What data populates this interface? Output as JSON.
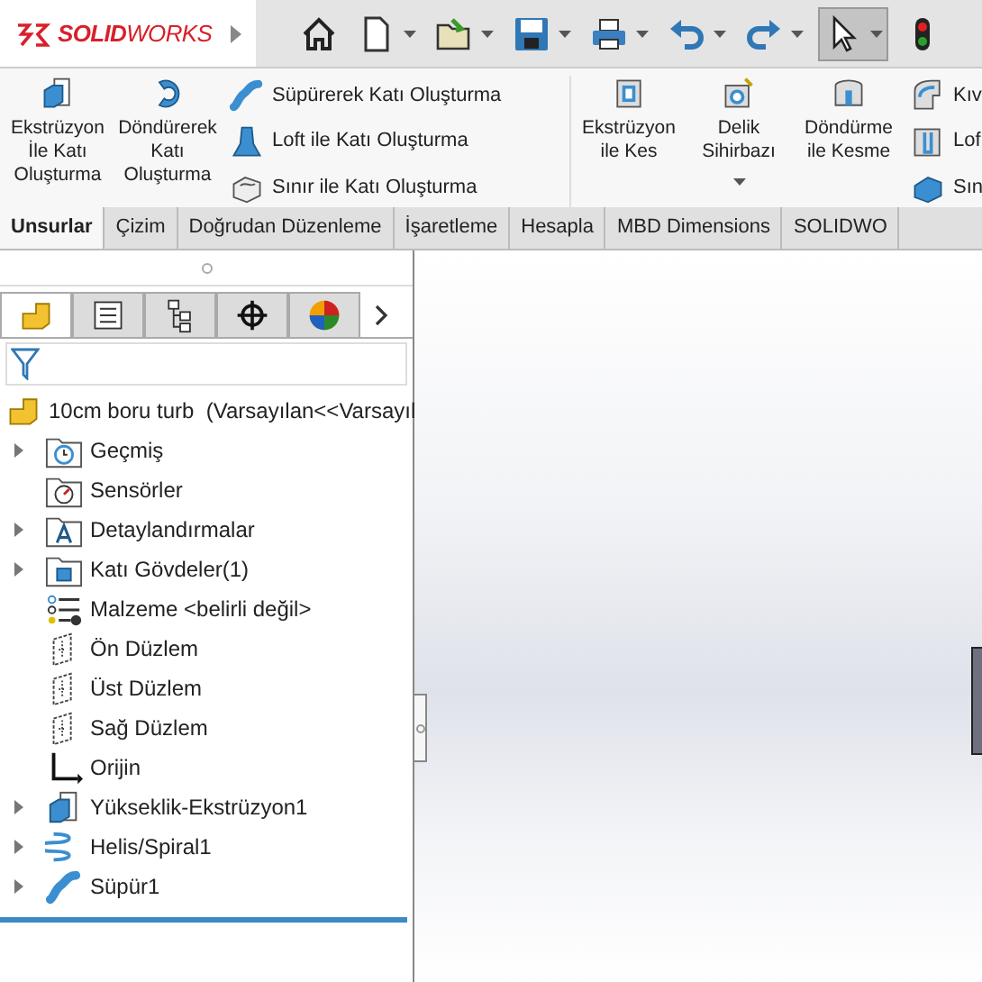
{
  "logo": {
    "text": "**SOLID**WORKS"
  },
  "toolbar": [
    {
      "kind": "home",
      "dropdown": false,
      "selected": false
    },
    {
      "kind": "new",
      "dropdown": true,
      "selected": false
    },
    {
      "kind": "open",
      "dropdown": true,
      "selected": false
    },
    {
      "kind": "save",
      "dropdown": true,
      "selected": false
    },
    {
      "kind": "print",
      "dropdown": true,
      "selected": false
    },
    {
      "kind": "undo",
      "dropdown": true,
      "selected": false
    },
    {
      "kind": "redo",
      "dropdown": true,
      "selected": false
    },
    {
      "kind": "select",
      "dropdown": true,
      "selected": true
    },
    {
      "kind": "traffic",
      "dropdown": false,
      "selected": false
    }
  ],
  "ribbon": {
    "groups": [
      {
        "large": [
          {
            "label": "Ekstrüzyon İle Katı Oluşturma",
            "kind": "extrude",
            "dropdown": false
          },
          {
            "label": "Döndürerek Katı Oluşturma",
            "kind": "revolve",
            "dropdown": false
          }
        ],
        "small": [
          {
            "label": "Süpürerek Katı Oluşturma",
            "kind": "sweep"
          },
          {
            "label": "Loft ile Katı Oluşturma",
            "kind": "loft"
          },
          {
            "label": "Sınır ile Katı Oluşturma",
            "kind": "boundary"
          }
        ]
      },
      {
        "large": [
          {
            "label": "Ekstrüzyon ile Kes",
            "kind": "cut",
            "dropdown": false
          },
          {
            "label": "Delik Sihirbazı",
            "kind": "hole",
            "dropdown": true
          },
          {
            "label": "Döndürme ile Kesme",
            "kind": "revcut",
            "dropdown": false
          }
        ],
        "small": [
          {
            "label": "Kıv",
            "kind": "sweepcut"
          },
          {
            "label": "Lof",
            "kind": "loftcut"
          },
          {
            "label": "Sın",
            "kind": "boundarycut"
          }
        ]
      }
    ]
  },
  "tabs": [
    {
      "label": "Unsurlar",
      "selected": true
    },
    {
      "label": "Çizim",
      "selected": false
    },
    {
      "label": "Doğrudan Düzenleme",
      "selected": false
    },
    {
      "label": "İşaretleme",
      "selected": false
    },
    {
      "label": "Hesapla",
      "selected": false
    },
    {
      "label": "MBD Dimensions",
      "selected": false
    },
    {
      "label": "SOLIDWO",
      "selected": false
    }
  ],
  "panel_tabs": [
    {
      "kind": "feature",
      "selected": true
    },
    {
      "kind": "property",
      "selected": false
    },
    {
      "kind": "config",
      "selected": false
    },
    {
      "kind": "dimxpert",
      "selected": false
    },
    {
      "kind": "display",
      "selected": false
    }
  ],
  "tree": {
    "root": "10cm boru turb  (Varsayılan<<Varsayıl",
    "items": [
      {
        "label": "Geçmiş",
        "kind": "history",
        "expandable": true
      },
      {
        "label": "Sensörler",
        "kind": "sensor",
        "expandable": false
      },
      {
        "label": "Detaylandırmalar",
        "kind": "annotation",
        "expandable": true
      },
      {
        "label": "Katı Gövdeler(1)",
        "kind": "bodies",
        "expandable": true
      },
      {
        "label": "Malzeme <belirli değil>",
        "kind": "material",
        "expandable": false
      },
      {
        "label": "Ön Düzlem",
        "kind": "plane",
        "expandable": false
      },
      {
        "label": "Üst Düzlem",
        "kind": "plane",
        "expandable": false
      },
      {
        "label": "Sağ Düzlem",
        "kind": "plane",
        "expandable": false
      },
      {
        "label": "Orijin",
        "kind": "origin",
        "expandable": false
      },
      {
        "label": "Yükseklik-Ekstrüzyon1",
        "kind": "extrude",
        "expandable": true
      },
      {
        "label": "Helis/Spiral1",
        "kind": "helix",
        "expandable": true
      },
      {
        "label": "Süpür1",
        "kind": "sweep",
        "expandable": true
      }
    ]
  }
}
